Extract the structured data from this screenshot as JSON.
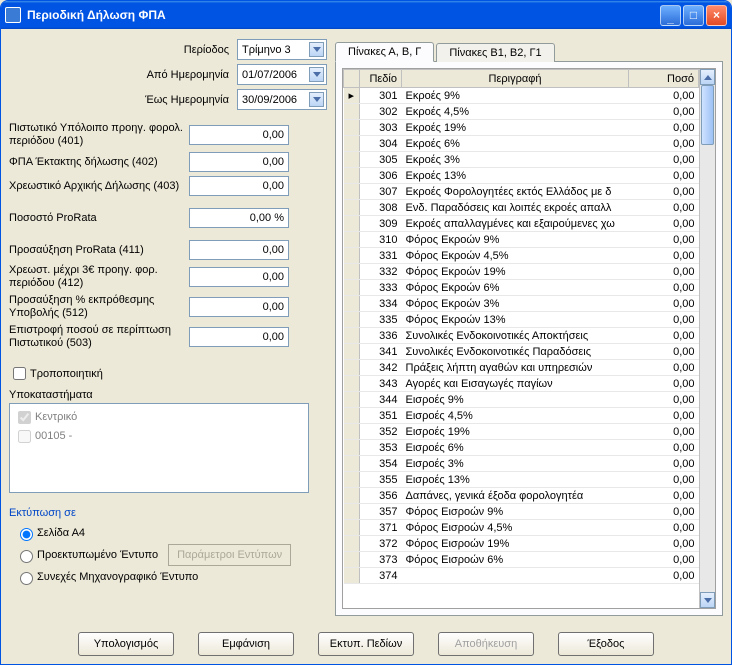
{
  "window": {
    "title": "Περιοδική Δήλωση ΦΠΑ"
  },
  "left": {
    "period_label": "Περίοδος",
    "period_value": "Τρίμηνο 3",
    "from_label": "Από Ημερομηνία",
    "from_value": "01/07/2006",
    "to_label": "Έως Ημερομηνία",
    "to_value": "30/09/2006",
    "f401_label": "Πιστωτικό Υπόλοιπο προηγ. φορολ. περιόδου (401)",
    "f401_value": "0,00",
    "f402_label": "ΦΠΑ Έκτακτης δήλωσης (402)",
    "f402_value": "0,00",
    "f403_label": "Χρεωστικό Αρχικής Δήλωσης (403)",
    "f403_value": "0,00",
    "prorata_label": "Ποσοστό ProRata",
    "prorata_value": "0,00 %",
    "f411_label": "Προσαύξηση ProRata (411)",
    "f411_value": "0,00",
    "f412_label": "Χρεωστ. μέχρι 3€ προηγ. φορ. περιόδου (412)",
    "f412_value": "0,00",
    "f512_label": "Προσαύξηση % εκπρόθεσμης Υποβολής (512)",
    "f512_value": "0,00",
    "f503_label": "Επιστροφή ποσού σε περίπτωση Πιστωτικού (503)",
    "f503_value": "0,00",
    "modif_label": "Τροποποιητική",
    "branches_label": "Υποκαταστήματα",
    "branches": [
      {
        "label": "Κεντρικό",
        "checked": true,
        "disabled": true
      },
      {
        "label": "00105 -",
        "checked": false,
        "disabled": true
      }
    ],
    "print_title": "Εκτύπωση σε",
    "print_options": [
      "Σελίδα Α4",
      "Προεκτυπωμένο Έντυπο",
      "Συνεχές Μηχανογραφικό Έντυπο"
    ],
    "print_selected": 0,
    "param_btn": "Παράμετροι Εντύπων"
  },
  "tabs": [
    "Πίνακες Α, Β, Γ",
    "Πίνακες Β1, Β2, Γ1"
  ],
  "active_tab": 0,
  "grid": {
    "headers": [
      "Πεδίο",
      "Περιγραφή",
      "Ποσό"
    ],
    "rows": [
      {
        "code": "301",
        "desc": "Εκροές 9%",
        "amount": "0,00"
      },
      {
        "code": "302",
        "desc": "Εκροές 4,5%",
        "amount": "0,00"
      },
      {
        "code": "303",
        "desc": "Εκροές 19%",
        "amount": "0,00"
      },
      {
        "code": "304",
        "desc": "Εκροές 6%",
        "amount": "0,00"
      },
      {
        "code": "305",
        "desc": "Εκροές 3%",
        "amount": "0,00"
      },
      {
        "code": "306",
        "desc": "Εκροές 13%",
        "amount": "0,00"
      },
      {
        "code": "307",
        "desc": "Εκροές Φορολογητέες εκτός Ελλάδος με δ",
        "amount": "0,00"
      },
      {
        "code": "308",
        "desc": "Ενδ. Παραδόσεις και λοιπές εκροές απαλλ",
        "amount": "0,00"
      },
      {
        "code": "309",
        "desc": "Εκροές απαλλαγμένες και εξαιρούμενες χω",
        "amount": "0,00"
      },
      {
        "code": "310",
        "desc": "Φόρος Εκροών 9%",
        "amount": "0,00"
      },
      {
        "code": "331",
        "desc": "Φόρος Εκροών 4,5%",
        "amount": "0,00"
      },
      {
        "code": "332",
        "desc": "Φόρος Εκροών 19%",
        "amount": "0,00"
      },
      {
        "code": "333",
        "desc": "Φόρος Εκροών 6%",
        "amount": "0,00"
      },
      {
        "code": "334",
        "desc": "Φόρος Εκροών 3%",
        "amount": "0,00"
      },
      {
        "code": "335",
        "desc": "Φόρος Εκροών 13%",
        "amount": "0,00"
      },
      {
        "code": "336",
        "desc": "Συνολικές Ενδοκοινοτικές Αποκτήσεις",
        "amount": "0,00"
      },
      {
        "code": "341",
        "desc": "Συνολικές Ενδοκοινοτικές Παραδόσεις",
        "amount": "0,00"
      },
      {
        "code": "342",
        "desc": "Πράξεις λήπτη αγαθών και υπηρεσιών",
        "amount": "0,00"
      },
      {
        "code": "343",
        "desc": "Αγορές και Εισαγωγές παγίων",
        "amount": "0,00"
      },
      {
        "code": "344",
        "desc": "Εισροές 9%",
        "amount": "0,00"
      },
      {
        "code": "351",
        "desc": "Εισροές 4,5%",
        "amount": "0,00"
      },
      {
        "code": "352",
        "desc": "Εισροές 19%",
        "amount": "0,00"
      },
      {
        "code": "353",
        "desc": "Εισροές 6%",
        "amount": "0,00"
      },
      {
        "code": "354",
        "desc": "Εισροές 3%",
        "amount": "0,00"
      },
      {
        "code": "355",
        "desc": "Εισροές 13%",
        "amount": "0,00"
      },
      {
        "code": "356",
        "desc": "Δαπάνες, γενικά έξοδα φορολογητέα",
        "amount": "0,00"
      },
      {
        "code": "357",
        "desc": "Φόρος Εισροών 9%",
        "amount": "0,00"
      },
      {
        "code": "371",
        "desc": "Φόρος Εισροών 4,5%",
        "amount": "0,00"
      },
      {
        "code": "372",
        "desc": "Φόρος Εισροών 19%",
        "amount": "0,00"
      },
      {
        "code": "373",
        "desc": "Φόρος Εισροών 6%",
        "amount": "0,00"
      },
      {
        "code": "374",
        "desc": "",
        "amount": "0,00"
      }
    ]
  },
  "buttons": {
    "calc": "Υπολογισμός",
    "show": "Εμφάνιση",
    "print_fields": "Εκτυπ. Πεδίων",
    "save": "Αποθήκευση",
    "exit": "Έξοδος"
  }
}
